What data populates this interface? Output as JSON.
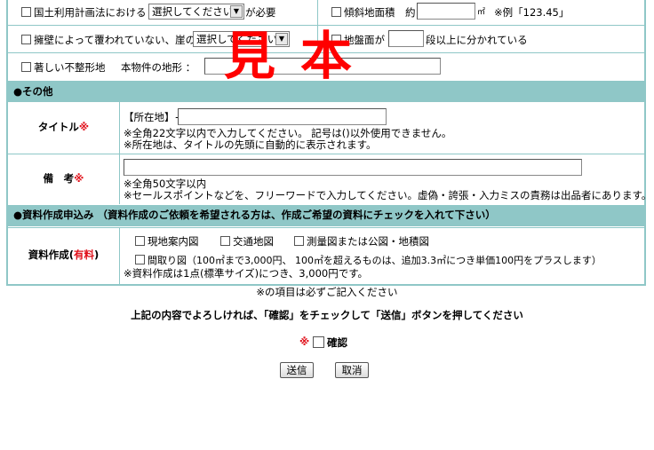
{
  "rows": {
    "land_law_label": "国土利用計画法における",
    "land_law_select": "選択してください",
    "land_law_suffix": "が必要",
    "slope_label": "傾斜地面積　約",
    "slope_unit": "㎡",
    "slope_example": "※例「123.45」",
    "retaining_label": "擁壁によって覆われていない、崖の",
    "retaining_select": "選択してください",
    "ground_label": "地盤面が",
    "ground_suffix": "段以上に分かれている",
    "irregular_label": "著しい不整形地",
    "shape_label": "本物件の地形 ："
  },
  "sections": {
    "other": "●その他",
    "docs": "●資料作成申込み （資料作成のご依頼を希望される方は、作成ご希望の資料にチェックを入れて下さい）"
  },
  "title_row": {
    "label": "タイトル",
    "req_mark": "※",
    "prefix": "【所在地】+",
    "note1": "※全角22文字以内で入力してください。 記号は()以外使用できません。",
    "note2": "※所在地は、タイトルの先頭に自動的に表示されます。"
  },
  "remarks_row": {
    "label": "備　考",
    "req_mark": "※",
    "note1": "※全角50文字以内",
    "note2": "※セールスポイントなどを、フリーワードで入力してください。虚偽・誇張・入力ミスの責務は出品者にあります。"
  },
  "docs_row": {
    "label": "資料作成(",
    "paid": "有料",
    "label_end": ")",
    "opt1": "現地案内図",
    "opt2": "交通地図",
    "opt3": "測量図または公図・地積図",
    "opt4": "間取り図（100㎡まで3,000円、 100㎡を超えるものは、追加3.3㎡につき単価100円をプラスします）",
    "note": "※資料作成は1点(標準サイズ)につき、3,000円です。"
  },
  "footer": {
    "required_note": "※の項目は必ずご記入ください",
    "instruction": "上記の内容でよろしければ、「確認」をチェックして「送信」ボタンを押してください",
    "confirm_mark": "※",
    "confirm_label": "確認",
    "submit": "送信",
    "cancel": "取消"
  },
  "stamp": "見本",
  "colors": {
    "border": "#8fc7c7",
    "band": "#8fc7c7",
    "required": "#e0101a",
    "stamp": "#ff0000"
  }
}
